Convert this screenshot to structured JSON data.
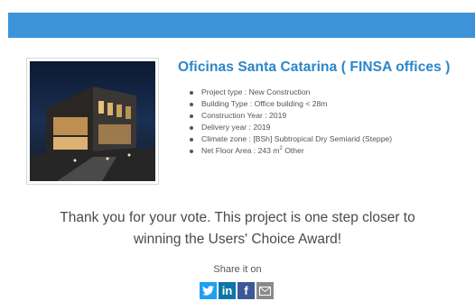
{
  "project": {
    "title": "Oficinas Santa Catarina ( FINSA offices )",
    "details": [
      {
        "label": "Project type",
        "value": "New Construction"
      },
      {
        "label": "Building Type",
        "value": "Office building < 28m"
      },
      {
        "label": "Construction Year",
        "value": "2019"
      },
      {
        "label": "Delivery year",
        "value": "2019"
      },
      {
        "label": "Climate zone",
        "value": "[BSh] Subtropical Dry Semiarid (Steppe)"
      },
      {
        "label": "Net Floor Area",
        "value": "243 m",
        "superscript": "2",
        "suffix": " Other"
      }
    ]
  },
  "vote_message": {
    "line1": "Thank you for your vote. This project is one step closer to",
    "line2": "winning the Users' Choice Award!"
  },
  "share": {
    "label": "Share it on",
    "buttons": [
      {
        "name": "twitter-icon",
        "color": "#1da1f2"
      },
      {
        "name": "linkedin-icon",
        "text": "in",
        "color": "#0e76a8"
      },
      {
        "name": "facebook-icon",
        "text": "f",
        "color": "#3b5998"
      },
      {
        "name": "email-icon",
        "color": "#8a8a8a"
      }
    ]
  },
  "colors": {
    "top_bar": "#3d93d8",
    "title": "#2b86c9"
  }
}
